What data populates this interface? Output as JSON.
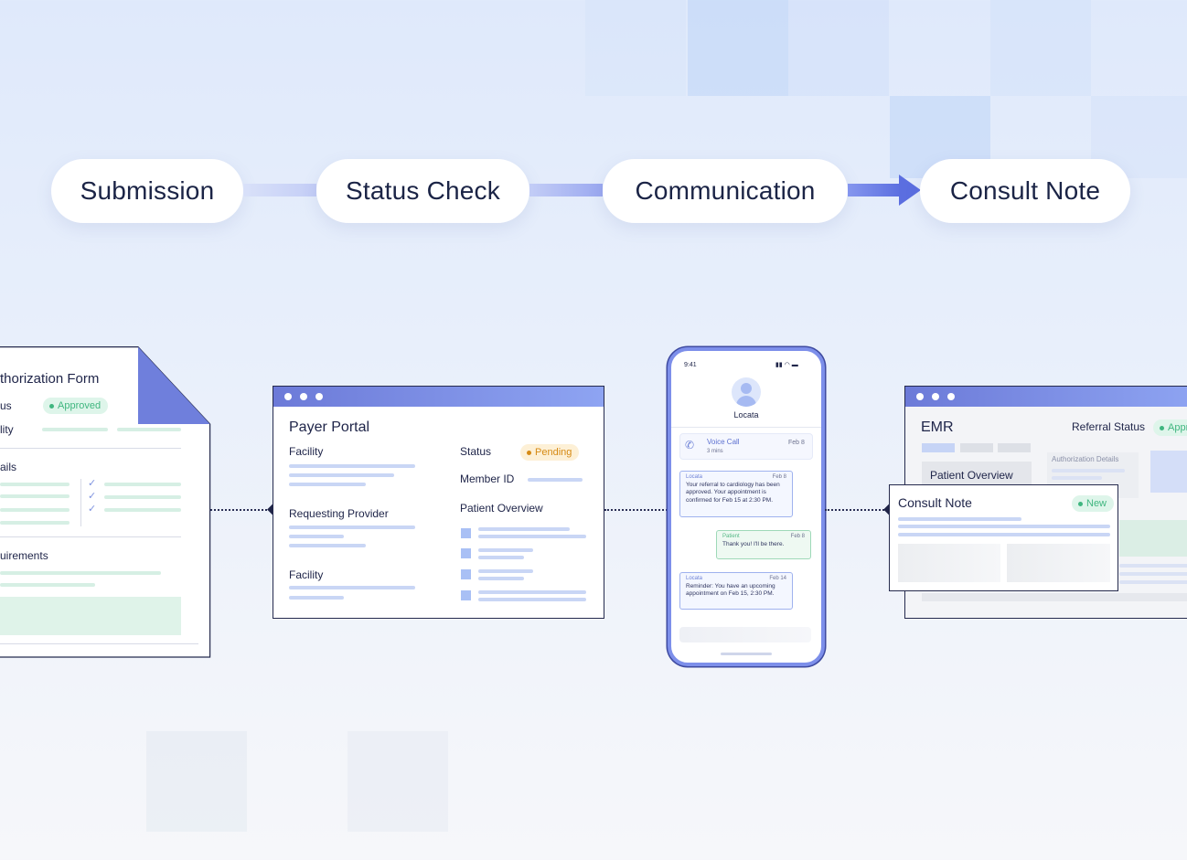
{
  "steps": [
    "Submission",
    "Status Check",
    "Communication",
    "Consult Note"
  ],
  "auth_form": {
    "title": "thorization Form",
    "row1_label": "us",
    "row1_badge": "Approved",
    "row2_label": "lity",
    "section2": "ails",
    "section3": "uirements"
  },
  "payer_portal": {
    "title": "Payer Portal",
    "facility_1": "Facility",
    "requesting_provider": "Requesting Provider",
    "facility_2": "Facility",
    "status_label": "Status",
    "status_badge": "Pending",
    "member_id": "Member ID",
    "patient_overview": "Patient Overview"
  },
  "phone": {
    "time": "9:41",
    "contact": "Locata",
    "call_title": "Voice Call",
    "call_sub": "3 mins",
    "call_date": "Feb 8",
    "messages": [
      {
        "from": "Locata",
        "date": "Feb 8",
        "text": "Your referral to cardiology has been approved. Your appointment is confirmed for Feb 15 at 2:30 PM."
      },
      {
        "from": "Patient",
        "date": "Feb 8",
        "text": "Thank you! I'll be there."
      },
      {
        "from": "Locata",
        "date": "Feb 14",
        "text": "Reminder: You have an upcoming appointment on Feb 15, 2:30 PM."
      }
    ]
  },
  "emr": {
    "title": "EMR",
    "referral_status": "Referral Status",
    "referral_badge": "Appro",
    "patient_overview": "Patient Overview",
    "auth_details": "Authorization Details",
    "consult_title": "Consult Note",
    "consult_badge": "New"
  },
  "colors": {
    "accent": "#5b6ee0",
    "titlebar": "#7a8ae2",
    "approved": "#3fb67f",
    "pending": "#d68a14"
  }
}
